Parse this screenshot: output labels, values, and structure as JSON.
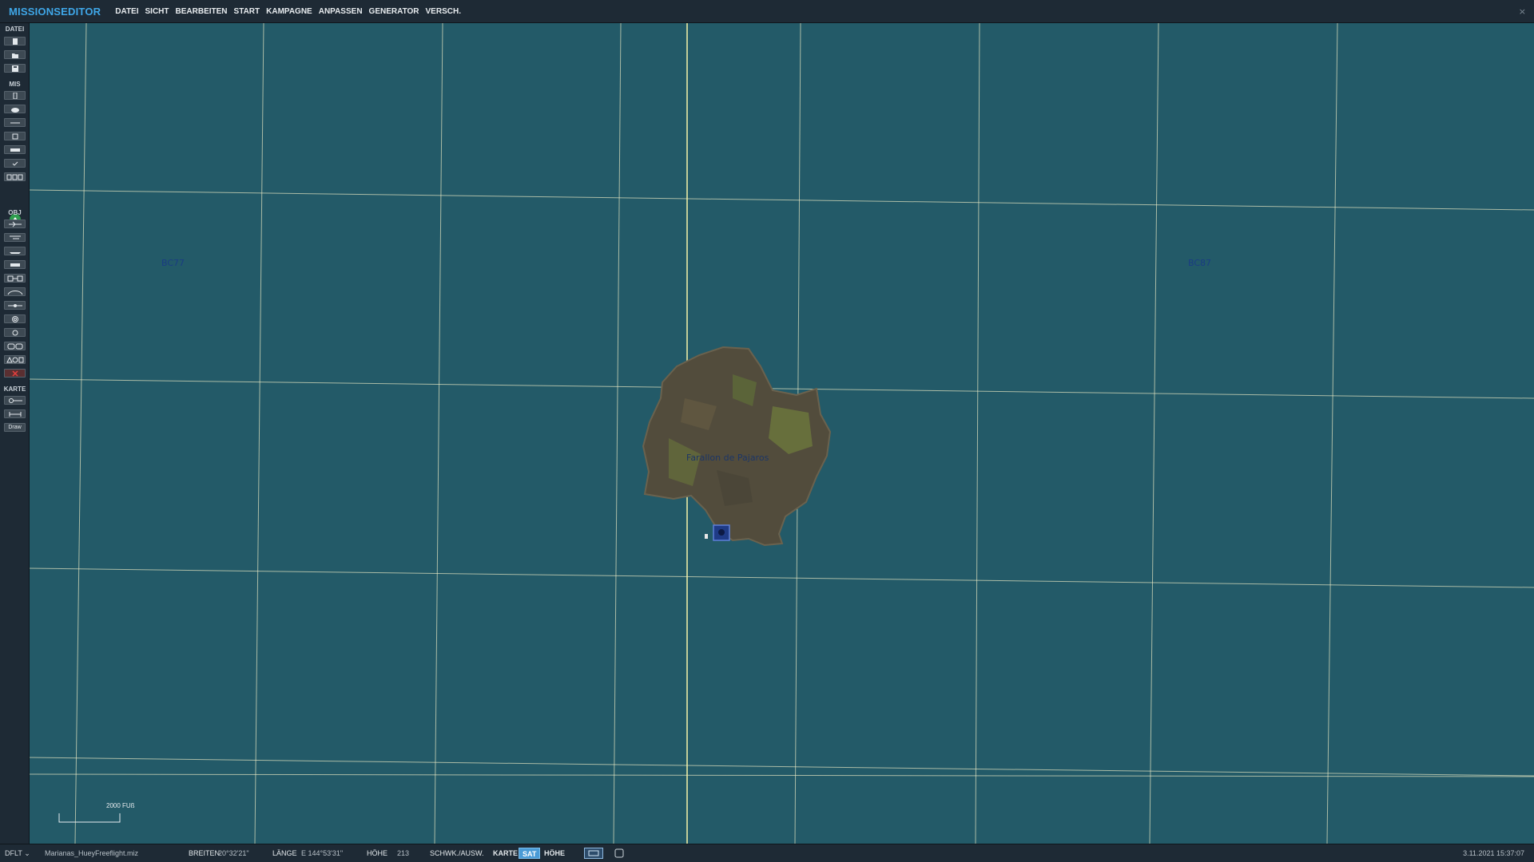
{
  "app": {
    "title": "MISSIONSEDITOR",
    "menu": [
      "DATEI",
      "SICHT",
      "BEARBEITEN",
      "START",
      "KAMPAGNE",
      "ANPASSEN",
      "GENERATOR",
      "VERSCH."
    ],
    "close_glyph": "×"
  },
  "toolbar": {
    "sections": {
      "file": "DATEI",
      "mission": "MIS",
      "objects": "OBJ",
      "map": "KARTE"
    },
    "draw_label": "Draw",
    "icons": {
      "file": [
        "new-mission-icon",
        "open-mission-icon",
        "save-mission-icon"
      ],
      "mission": [
        "mission-briefing-icon",
        "weather-icon",
        "time-icon",
        "options-icon",
        "failures-icon",
        "check-icon",
        "triggers-icon"
      ],
      "objects": [
        "aircraft-icon",
        "helicopter-icon",
        "ship-icon",
        "ground-unit-icon",
        "static-object-icon",
        "airfield-icon",
        "template-icon",
        "zone-icon",
        "target-icon",
        "route-icon",
        "draw-shapes-icon",
        "delete-icon"
      ],
      "map": [
        "ruler-icon",
        "measure-icon"
      ]
    }
  },
  "map": {
    "grid_labels": [
      "BC77",
      "BC87"
    ],
    "island_label": "Farallon de Pajaros",
    "scale_label": "2000 FUß",
    "colors": {
      "sea": "#235a68",
      "grid": "#f2f0c8",
      "label": "#1a3c83"
    }
  },
  "status": {
    "profile": "DFLT",
    "profile_chevron": "⌄",
    "filename": "Marianas_HueyFreeflight.miz",
    "lat_label": "BREITEN",
    "lat_value": "20°32'21\"",
    "lon_label": "LÄNGE",
    "lon_value": "E 144°53'31\"",
    "alt_label": "HÖHE",
    "alt_value": "213",
    "toggle_label": "SCHWK./AUSW.",
    "modes": [
      "KARTE",
      "SAT",
      "HÖHE"
    ],
    "active_mode": "SAT",
    "datetime": "3.11.2021 15:37:07"
  }
}
